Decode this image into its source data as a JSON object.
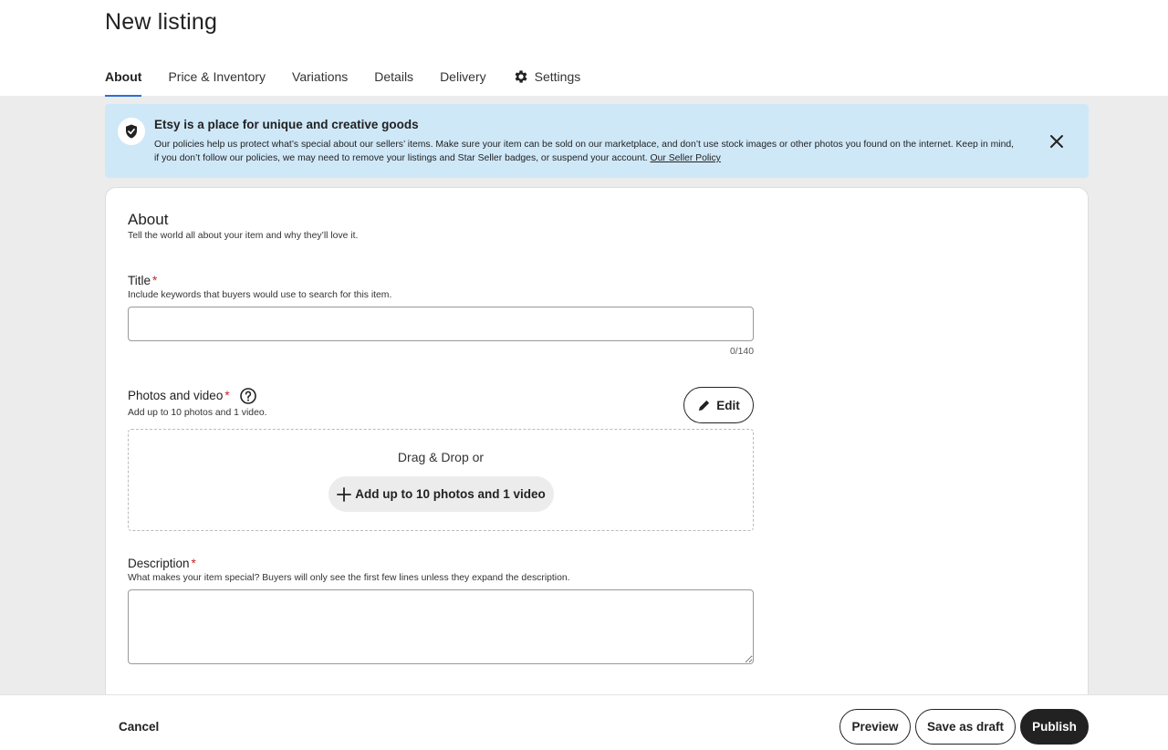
{
  "page": {
    "title": "New listing"
  },
  "tabs": [
    {
      "label": "About",
      "active": true
    },
    {
      "label": "Price & Inventory"
    },
    {
      "label": "Variations"
    },
    {
      "label": "Details"
    },
    {
      "label": "Delivery"
    },
    {
      "label": "Settings",
      "icon": "gear-icon"
    }
  ],
  "banner": {
    "icon": "shield-check-icon",
    "title": "Etsy is a place for unique and creative goods",
    "text": "Our policies help us protect what’s special about our sellers’ items. Make sure your item can be sold on our marketplace, and don’t use stock images or other photos you found on the internet. Keep in mind, if you don’t follow our policies, we may need to remove your listings and Star Seller badges, or suspend your account.",
    "link": "Our Seller Policy",
    "close_icon": "close-icon"
  },
  "about": {
    "title": "About",
    "subtitle": "Tell the world all about your item and why they’ll love it."
  },
  "title_field": {
    "label": "Title",
    "required_mark": "*",
    "help": "Include keywords that buyers would use to search for this item.",
    "value": "",
    "counter": "0/140"
  },
  "photos": {
    "label": "Photos and video",
    "required_mark": "*",
    "help": "Add up to 10 photos and 1 video.",
    "edit_label": "Edit",
    "drop_text": "Drag & Drop or",
    "add_label": "Add up to 10 photos and 1 video"
  },
  "description": {
    "label": "Description",
    "required_mark": "*",
    "help": "What makes your item special? Buyers will only see the first few lines unless they expand the description.",
    "value": ""
  },
  "footer": {
    "cancel": "Cancel",
    "preview": "Preview",
    "save_draft": "Save as draft",
    "publish": "Publish"
  },
  "colors": {
    "accent": "#2a6fd6",
    "banner_bg": "#cfe8f8",
    "required": "#c1272d",
    "primary_button": "#222222"
  }
}
